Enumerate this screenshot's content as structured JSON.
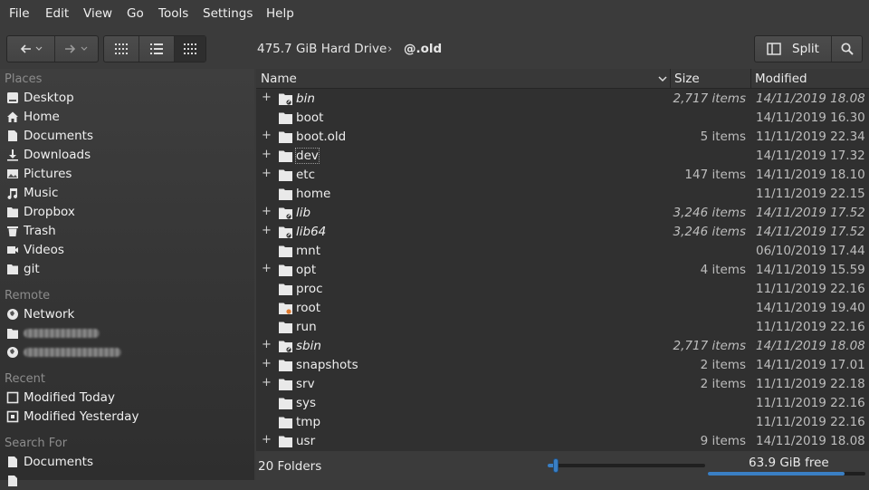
{
  "menu": [
    "File",
    "Edit",
    "View",
    "Go",
    "Tools",
    "Settings",
    "Help"
  ],
  "breadcrumb": {
    "drive": "475.7 GiB Hard Drive",
    "separator": "›",
    "current": "@.old"
  },
  "toolbar": {
    "split_label": "Split"
  },
  "sidebar": {
    "places_title": "Places",
    "places": [
      {
        "label": "Desktop",
        "icon": "desktop-icon"
      },
      {
        "label": "Home",
        "icon": "home-icon"
      },
      {
        "label": "Documents",
        "icon": "documents-icon"
      },
      {
        "label": "Downloads",
        "icon": "downloads-icon"
      },
      {
        "label": "Pictures",
        "icon": "pictures-icon"
      },
      {
        "label": "Music",
        "icon": "music-icon"
      },
      {
        "label": "Dropbox",
        "icon": "dropbox-folder-icon"
      },
      {
        "label": "Trash",
        "icon": "trash-icon"
      },
      {
        "label": "Videos",
        "icon": "videos-icon"
      },
      {
        "label": "git",
        "icon": "folder-icon"
      }
    ],
    "remote_title": "Remote",
    "remote": [
      {
        "label": "Network",
        "icon": "network-icon"
      }
    ],
    "recent_title": "Recent",
    "recent": [
      {
        "label": "Modified Today",
        "icon": "calendar-today-icon"
      },
      {
        "label": "Modified Yesterday",
        "icon": "calendar-yesterday-icon"
      }
    ],
    "search_title": "Search For",
    "search": [
      {
        "label": "Documents",
        "icon": "documents-icon"
      }
    ]
  },
  "columns": {
    "name": "Name",
    "size": "Size",
    "modified": "Modified"
  },
  "files": [
    {
      "name": "bin",
      "size": "2,717 items",
      "modified": "14/11/2019 18.08",
      "expandable": true,
      "symlink": true
    },
    {
      "name": "boot",
      "size": "",
      "modified": "14/11/2019 16.30",
      "expandable": false,
      "symlink": false
    },
    {
      "name": "boot.old",
      "size": "5 items",
      "modified": "11/11/2019 22.34",
      "expandable": true,
      "symlink": false
    },
    {
      "name": "dev",
      "size": "",
      "modified": "14/11/2019 17.32",
      "expandable": true,
      "symlink": false
    },
    {
      "name": "etc",
      "size": "147 items",
      "modified": "14/11/2019 18.10",
      "expandable": true,
      "symlink": false
    },
    {
      "name": "home",
      "size": "",
      "modified": "11/11/2019 22.15",
      "expandable": false,
      "symlink": false
    },
    {
      "name": "lib",
      "size": "3,246 items",
      "modified": "14/11/2019 17.52",
      "expandable": true,
      "symlink": true
    },
    {
      "name": "lib64",
      "size": "3,246 items",
      "modified": "14/11/2019 17.52",
      "expandable": true,
      "symlink": true
    },
    {
      "name": "mnt",
      "size": "",
      "modified": "06/10/2019 17.44",
      "expandable": false,
      "symlink": false
    },
    {
      "name": "opt",
      "size": "4 items",
      "modified": "14/11/2019 15.59",
      "expandable": true,
      "symlink": false
    },
    {
      "name": "proc",
      "size": "",
      "modified": "11/11/2019 22.16",
      "expandable": false,
      "symlink": false
    },
    {
      "name": "root",
      "size": "",
      "modified": "14/11/2019 19.40",
      "expandable": false,
      "symlink": false,
      "locked": true
    },
    {
      "name": "run",
      "size": "",
      "modified": "11/11/2019 22.16",
      "expandable": false,
      "symlink": false
    },
    {
      "name": "sbin",
      "size": "2,717 items",
      "modified": "14/11/2019 18.08",
      "expandable": true,
      "symlink": true
    },
    {
      "name": "snapshots",
      "size": "2 items",
      "modified": "14/11/2019 17.01",
      "expandable": true,
      "symlink": false
    },
    {
      "name": "srv",
      "size": "2 items",
      "modified": "11/11/2019 22.18",
      "expandable": true,
      "symlink": false
    },
    {
      "name": "sys",
      "size": "",
      "modified": "11/11/2019 22.16",
      "expandable": false,
      "symlink": false
    },
    {
      "name": "tmp",
      "size": "",
      "modified": "11/11/2019 22.16",
      "expandable": false,
      "symlink": false
    },
    {
      "name": "usr",
      "size": "9 items",
      "modified": "14/11/2019 18.08",
      "expandable": true,
      "symlink": false
    }
  ],
  "status": {
    "summary": "20 Folders",
    "free": "63.9 GiB free",
    "zoom_fraction": 0.05,
    "used_fraction": 0.87
  },
  "colors": {
    "accent": "#3a7fc4",
    "locked_badge": "#e07a2e"
  }
}
